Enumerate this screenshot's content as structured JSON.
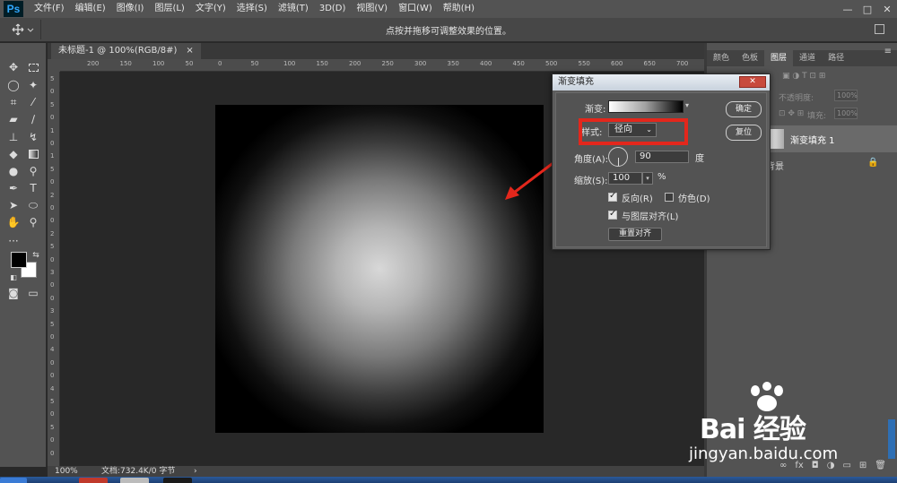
{
  "menubar": {
    "logo": "Ps",
    "items": [
      "文件(F)",
      "编辑(E)",
      "图像(I)",
      "图层(L)",
      "文字(Y)",
      "选择(S)",
      "滤镜(T)",
      "3D(D)",
      "视图(V)",
      "窗口(W)",
      "帮助(H)"
    ],
    "window_controls": [
      "—",
      "□",
      "✕"
    ]
  },
  "options_bar": {
    "hint": "点按并拖移可调整效果的位置。"
  },
  "document": {
    "tab_title": "未标题-1 @ 100%(RGB/8#)",
    "tab_close": "×"
  },
  "rulers": {
    "h_labels": [
      "200",
      "150",
      "100",
      "50",
      "0",
      "50",
      "100",
      "150",
      "200",
      "250",
      "300",
      "350",
      "400",
      "450",
      "500",
      "550",
      "600",
      "650",
      "700"
    ],
    "v_labels": [
      "5",
      "0",
      "5",
      "0",
      "1",
      "0",
      "1",
      "5",
      "0",
      "2",
      "0",
      "0",
      "2",
      "5",
      "0",
      "3",
      "0",
      "0",
      "3",
      "5",
      "0",
      "4",
      "0",
      "0",
      "4",
      "5",
      "0",
      "5",
      "0",
      "0"
    ]
  },
  "status": {
    "zoom": "100%",
    "doc_info": "文档:732.4K/0 字节",
    "arrow": "›"
  },
  "panel": {
    "tabs": [
      "颜色",
      "色板",
      "图层",
      "通道",
      "路径"
    ],
    "active_tab": "图层",
    "opacity_label": "不透明度:",
    "opacity_value": "100%",
    "fill_label": "填充:",
    "fill_value": "100%",
    "layer_name": "渐变填充 1",
    "bg_layer_name": "背景",
    "footer_icons": [
      "∞",
      "fx",
      "◘",
      "◑",
      "▭",
      "⊞",
      "🗑"
    ]
  },
  "dialog": {
    "title": "渐变填充",
    "close_label": "✕",
    "gradient_label": "渐变:",
    "style_label": "样式:",
    "style_value": "径向",
    "angle_label": "角度(A):",
    "angle_value": "90",
    "angle_unit": "度",
    "scale_label": "缩放(S):",
    "scale_value": "100",
    "scale_unit": "%",
    "reverse_label": "反向(R)",
    "reverse_checked": true,
    "dither_label": "仿色(D)",
    "dither_checked": false,
    "align_label": "与图层对齐(L)",
    "align_checked": true,
    "reset_align_label": "重置对齐",
    "ok_label": "确定",
    "reset_label": "复位"
  },
  "watermark": {
    "text": "Bai 经验",
    "url": "jingyan.baidu.com"
  },
  "colors": {
    "highlight": "#e3271c",
    "arrow": "#e3271c",
    "foreground": "#000000",
    "background": "#ffffff"
  }
}
